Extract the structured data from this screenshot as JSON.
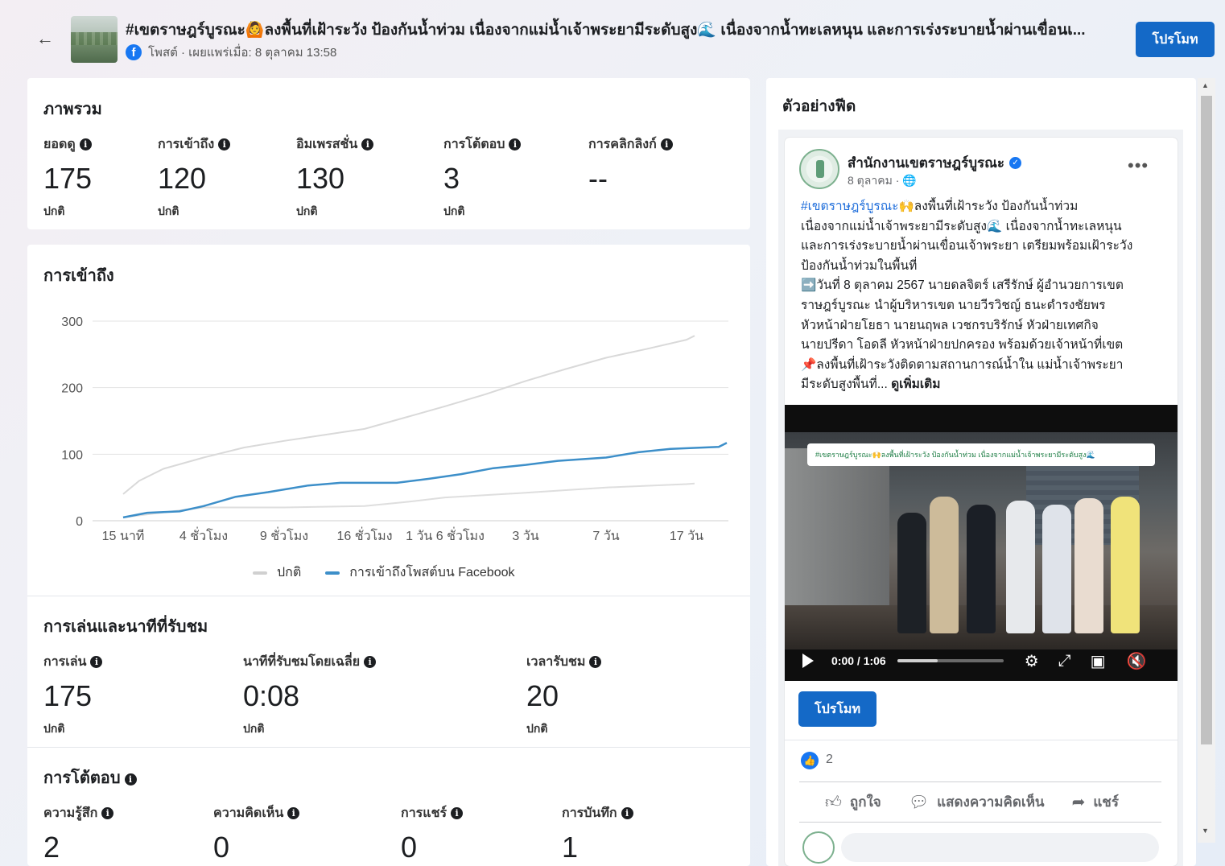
{
  "header": {
    "title": "#เขตราษฎร์บูรณะ🙆ลงพื้นที่เฝ้าระวัง ป้องกันน้ำท่วม เนื่องจากแม่น้ำเจ้าพระยามีระดับสูง🌊 เนื่องจากน้ำทะเลหนุน และการเร่งระบายน้ำผ่านเขื่อนเ...",
    "meta": "โพสต์ · เผยแพร่เมื่อ: 8 ตุลาคม 13:58",
    "promote_label": "โปรโมท"
  },
  "overview": {
    "title": "ภาพรวม",
    "metrics": [
      {
        "label": "ยอดดู",
        "value": "175",
        "sub": "ปกติ"
      },
      {
        "label": "การเข้าถึง",
        "value": "120",
        "sub": "ปกติ"
      },
      {
        "label": "อิมเพรสชั่น",
        "value": "130",
        "sub": "ปกติ"
      },
      {
        "label": "การโต้ตอบ",
        "value": "3",
        "sub": "ปกติ"
      },
      {
        "label": "การคลิกลิงก์",
        "value": "--",
        "sub": ""
      }
    ]
  },
  "reach": {
    "title": "การเข้าถึง"
  },
  "chart_data": {
    "type": "line",
    "title": "การเข้าถึง",
    "x": [
      "15 นาที",
      "4 ชั่วโมง",
      "9 ชั่วโมง",
      "16 ชั่วโมง",
      "1 วัน 6 ชั่วโมง",
      "3 วัน",
      "7 วัน",
      "17 วัน"
    ],
    "y_ticks": [
      0,
      100,
      200,
      300
    ],
    "ylim": [
      0,
      300
    ],
    "grid": true,
    "legend_position": "bottom",
    "series": [
      {
        "name": "ปกติ",
        "color": "#d9d9d9",
        "points": [
          [
            0,
            40
          ],
          [
            0.2,
            60
          ],
          [
            0.5,
            78
          ],
          [
            1,
            95
          ],
          [
            1.5,
            110
          ],
          [
            2,
            120
          ],
          [
            3,
            138
          ],
          [
            3.5,
            155
          ],
          [
            4,
            172
          ],
          [
            4.5,
            190
          ],
          [
            5,
            210
          ],
          [
            5.5,
            228
          ],
          [
            6,
            245
          ],
          [
            6.5,
            258
          ],
          [
            7,
            272
          ],
          [
            7.1,
            278
          ]
        ]
      },
      {
        "name": "ปกติ",
        "color": "#dedede",
        "points": [
          [
            0,
            5
          ],
          [
            1,
            20
          ],
          [
            2,
            20
          ],
          [
            3,
            22
          ],
          [
            3.5,
            28
          ],
          [
            4,
            35
          ],
          [
            5,
            42
          ],
          [
            6,
            50
          ],
          [
            7,
            55
          ],
          [
            7.1,
            56
          ]
        ]
      },
      {
        "name": "การเข้าถึงโพสต์บน Facebook",
        "color": "#3d8fc9",
        "points": [
          [
            0,
            5
          ],
          [
            0.3,
            12
          ],
          [
            0.7,
            14
          ],
          [
            1,
            22
          ],
          [
            1.4,
            36
          ],
          [
            1.8,
            43
          ],
          [
            2.3,
            53
          ],
          [
            2.7,
            57
          ],
          [
            3,
            57
          ],
          [
            3.4,
            57
          ],
          [
            3.8,
            63
          ],
          [
            4.2,
            70
          ],
          [
            4.6,
            79
          ],
          [
            5,
            84
          ],
          [
            5.4,
            90
          ],
          [
            6,
            95
          ],
          [
            6.4,
            103
          ],
          [
            6.8,
            108
          ],
          [
            7.4,
            111
          ],
          [
            7.5,
            117
          ]
        ]
      }
    ],
    "legend": [
      {
        "label": "ปกติ",
        "color": "#d0d0d0"
      },
      {
        "label": "การเข้าถึงโพสต์บน Facebook",
        "color": "#3d8fc9"
      }
    ]
  },
  "plays": {
    "title": "การเล่นและนาทีที่รับชม",
    "metrics": [
      {
        "label": "การเล่น",
        "value": "175",
        "sub": "ปกติ"
      },
      {
        "label": "นาทีที่รับชมโดยเฉลี่ย",
        "value": "0:08",
        "sub": "ปกติ"
      },
      {
        "label": "เวลารับชม",
        "value": "20",
        "sub": "ปกติ"
      }
    ]
  },
  "engagement": {
    "title": "การโต้ตอบ",
    "metrics": [
      {
        "label": "ความรู้สึก",
        "value": "2"
      },
      {
        "label": "ความคิดเห็น",
        "value": "0"
      },
      {
        "label": "การแชร์",
        "value": "0"
      },
      {
        "label": "การบันทึก",
        "value": "1"
      }
    ]
  },
  "preview": {
    "title": "ตัวอย่างฟีด",
    "page_name": "สำนักงานเขตราษฎร์บูรณะ",
    "post_date": "8 ตุลาคม · 🌐",
    "text_lines": [
      {
        "hashtag": "#เขตราษฎร์บูรณะ",
        "rest": "🙌ลงพื้นที่เฝ้าระวัง ป้องกันน้ำท่วม"
      },
      {
        "hashtag": "",
        "rest": "เนื่องจากแม่น้ำเจ้าพระยามีระดับสูง🌊 เนื่องจากน้ำทะเลหนุน"
      },
      {
        "hashtag": "",
        "rest": "และการเร่งระบายน้ำผ่านเขื่อนเจ้าพระยา เตรียมพร้อมเฝ้าระวัง"
      },
      {
        "hashtag": "",
        "rest": "ป้องกันน้ำท่วมในพื้นที่"
      },
      {
        "hashtag": "",
        "rest": "➡️วันที่ 8 ตุลาคม 2567 นายดลจิตร์ เสรีรักษ์ ผู้อำนวยการเขต"
      },
      {
        "hashtag": "",
        "rest": "ราษฎร์บูรณะ นำผู้บริหารเขต นายวีรวิชญ์ ธนะดำรงชัยพร"
      },
      {
        "hashtag": "",
        "rest": "หัวหน้าฝ่ายโยธา นายนฤพล เวชกรบริรักษ์ หัวฝ่ายเทศกิจ"
      },
      {
        "hashtag": "",
        "rest": "นายปรีดา โอดลี หัวหน้าฝ่ายปกครอง พร้อมด้วยเจ้าหน้าที่เขต"
      },
      {
        "hashtag": "",
        "rest": "📌ลงพื้นที่เฝ้าระวังติดตามสถานการณ์น้ำใน แม่น้ำเจ้าพระยา"
      }
    ],
    "last_line": "มีระดับสูงพื้นที่...",
    "see_more": "ดูเพิ่มเติม",
    "video_banner": "#เขตราษฎร์บูรณะ🙌ลงพื้นที่เฝ้าระวัง ป้องกันน้ำท่วม เนื่องจากแม่น้ำเจ้าพระยามีระดับสูง🌊",
    "video_time": "0:00 / 1:06",
    "video_progress": 0.38,
    "promote_label": "โปรโมท",
    "like_count": "2",
    "actions": {
      "like": "ถูกใจ",
      "comment": "แสดงความคิดเห็น",
      "share": "แชร์"
    }
  }
}
